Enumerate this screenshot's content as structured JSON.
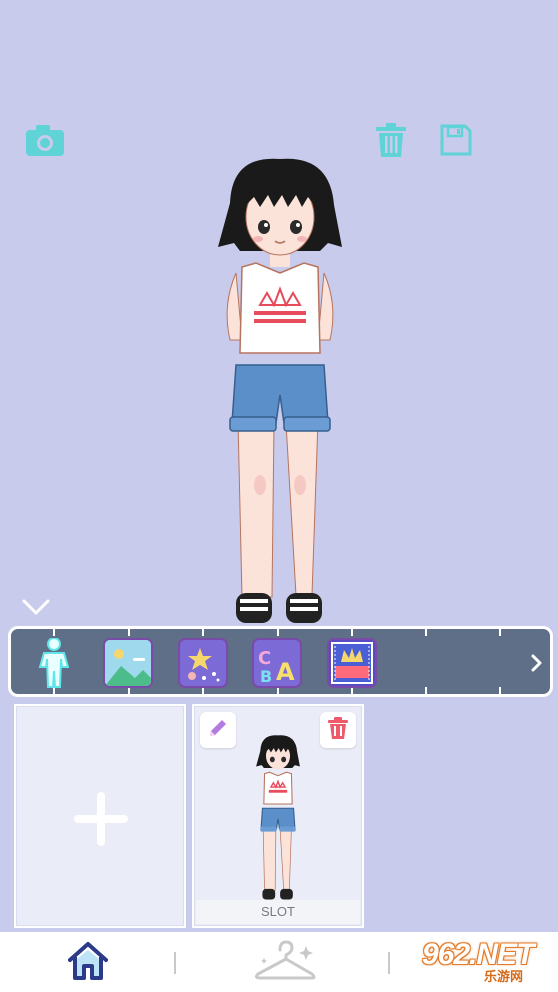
{
  "toolbar": {
    "camera_icon": "camera-icon",
    "trash_icon": "trash-icon",
    "save_icon": "save-icon",
    "accent_color": "#5fd3d6"
  },
  "categories": {
    "items": [
      {
        "name": "body",
        "icon": "person-icon",
        "selected": true
      },
      {
        "name": "background",
        "icon": "landscape-icon",
        "selected": false
      },
      {
        "name": "effects",
        "icon": "star-sparkle-icon",
        "selected": false
      },
      {
        "name": "text",
        "icon": "letters-icon",
        "selected": false
      },
      {
        "name": "frame",
        "icon": "crown-frame-icon",
        "selected": false
      }
    ],
    "bar_color": "#5f6f88",
    "next_icon": "chevron-right-icon"
  },
  "slots": {
    "add_icon": "plus-icon",
    "saved": [
      {
        "label": "SLOT",
        "edit_icon": "pencil-icon",
        "delete_icon": "trash-icon"
      }
    ]
  },
  "bottom_nav": {
    "items": [
      {
        "name": "home",
        "icon": "home-icon",
        "active": true
      },
      {
        "name": "wardrobe",
        "icon": "hanger-icon",
        "active": false
      }
    ]
  },
  "watermark": {
    "main": "962.NET",
    "sub": "乐游网"
  }
}
